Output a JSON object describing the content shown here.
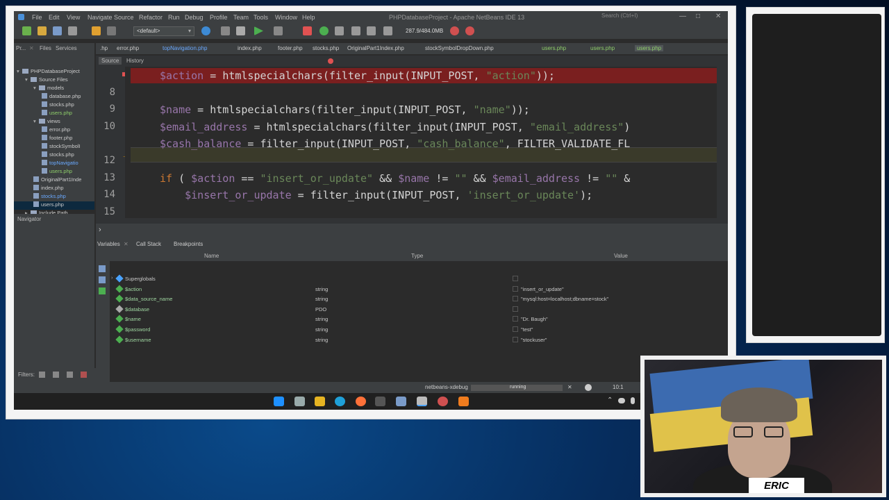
{
  "window": {
    "title": "PHPDatabaseProject - Apache NetBeans IDE 13",
    "search_placeholder": "Search (Ctrl+I)"
  },
  "menu": [
    "File",
    "Edit",
    "View",
    "Navigate",
    "Source",
    "Refactor",
    "Run",
    "Debug",
    "Profile",
    "Team",
    "Tools",
    "Window",
    "Help"
  ],
  "toolbar": {
    "config": "<default>",
    "memory": "287.9/484.0MB"
  },
  "project_panel": {
    "tabs": [
      "Pr...",
      "Files",
      "Services"
    ],
    "tree": [
      {
        "label": "PHPDatabaseProject",
        "depth": 0,
        "kind": "project"
      },
      {
        "label": "Source Files",
        "depth": 1,
        "kind": "folder"
      },
      {
        "label": "models",
        "depth": 2,
        "kind": "folder"
      },
      {
        "label": "database.php",
        "depth": 3,
        "kind": "file"
      },
      {
        "label": "stocks.php",
        "depth": 3,
        "kind": "file"
      },
      {
        "label": "users.php",
        "depth": 3,
        "kind": "file-mod"
      },
      {
        "label": "views",
        "depth": 2,
        "kind": "folder"
      },
      {
        "label": "error.php",
        "depth": 3,
        "kind": "file"
      },
      {
        "label": "footer.php",
        "depth": 3,
        "kind": "file"
      },
      {
        "label": "stockSymbolI",
        "depth": 3,
        "kind": "file"
      },
      {
        "label": "stocks.php",
        "depth": 3,
        "kind": "file"
      },
      {
        "label": "topNavigatio",
        "depth": 3,
        "kind": "file-link"
      },
      {
        "label": "users.php",
        "depth": 3,
        "kind": "file-mod"
      },
      {
        "label": "OriginalPart1Inde",
        "depth": 2,
        "kind": "file"
      },
      {
        "label": "index.php",
        "depth": 2,
        "kind": "file"
      },
      {
        "label": "stocks.php",
        "depth": 2,
        "kind": "file-link"
      },
      {
        "label": "users.php",
        "depth": 2,
        "kind": "file-sel"
      },
      {
        "label": "Include Path",
        "depth": 1,
        "kind": "folder"
      }
    ],
    "navigator_label": "Navigator"
  },
  "editor_tabs": [
    ".hp",
    "error.php",
    "topNavigation.php",
    "index.php",
    "footer.php",
    "stocks.php",
    "OriginalPart1Index.php",
    "stockSymbolDropDown.php",
    "users.php",
    "users.php",
    "users.php"
  ],
  "source_tabs": [
    "Source",
    "History"
  ],
  "code": {
    "lines": [
      {
        "num": "",
        "parts": [
          [
            "v",
            "$action"
          ],
          [
            "f",
            " = "
          ],
          [
            "f",
            "htmlspecialchars"
          ],
          [
            "f",
            "("
          ],
          [
            "f",
            "filter_input"
          ],
          [
            "f",
            "(INPUT_POST, "
          ],
          [
            "s",
            "\"action\""
          ],
          [
            "f",
            "));"
          ]
        ]
      },
      {
        "num": "8",
        "parts": []
      },
      {
        "num": "9",
        "parts": [
          [
            "v",
            "$name"
          ],
          [
            "f",
            " = "
          ],
          [
            "f",
            "htmlspecialchars"
          ],
          [
            "f",
            "("
          ],
          [
            "f",
            "filter_input"
          ],
          [
            "f",
            "(INPUT_POST, "
          ],
          [
            "s",
            "\"name\""
          ],
          [
            "f",
            "));"
          ]
        ]
      },
      {
        "num": "10",
        "parts": [
          [
            "v",
            "$email_address"
          ],
          [
            "f",
            " = "
          ],
          [
            "f",
            "htmlspecialchars"
          ],
          [
            "f",
            "("
          ],
          [
            "f",
            "filter_input"
          ],
          [
            "f",
            "(INPUT_POST, "
          ],
          [
            "s",
            "\"email_address\""
          ],
          [
            "f",
            ")"
          ]
        ]
      },
      {
        "num": "",
        "parts": [
          [
            "v",
            "$cash_balance"
          ],
          [
            "f",
            " = "
          ],
          [
            "f",
            "filter_input"
          ],
          [
            "f",
            "(INPUT_POST, "
          ],
          [
            "s",
            "\"cash_balance\""
          ],
          [
            "f",
            ", FILTER_VALIDATE_FL"
          ]
        ]
      },
      {
        "num": "12",
        "parts": []
      },
      {
        "num": "13",
        "parts": [
          [
            "k",
            "if"
          ],
          [
            "f",
            " ( "
          ],
          [
            "v",
            "$action"
          ],
          [
            "f",
            " == "
          ],
          [
            "s",
            "\"insert_or_update\""
          ],
          [
            "f",
            " && "
          ],
          [
            "v",
            "$name"
          ],
          [
            "f",
            " != "
          ],
          [
            "s",
            "\"\""
          ],
          [
            "f",
            " && "
          ],
          [
            "v",
            "$email_address"
          ],
          [
            "f",
            " != "
          ],
          [
            "s",
            "\"\""
          ],
          [
            "f",
            " &"
          ]
        ]
      },
      {
        "num": "14",
        "parts": [
          [
            "f",
            "    "
          ],
          [
            "v",
            "$insert_or_update"
          ],
          [
            "f",
            " = "
          ],
          [
            "f",
            "filter_input"
          ],
          [
            "f",
            "(INPUT_POST, "
          ],
          [
            "s",
            "'insert_or_update'"
          ],
          [
            "f",
            ");"
          ]
        ]
      },
      {
        "num": "15",
        "parts": []
      }
    ]
  },
  "debug_tabs": [
    "Variables",
    "Call Stack",
    "Breakpoints"
  ],
  "variables": {
    "headers": [
      "Name",
      "Type",
      "Value"
    ],
    "rows": [
      {
        "name": "Superglobals",
        "type": "",
        "value": ""
      },
      {
        "name": "$action",
        "type": "string",
        "value": "\"insert_or_update\""
      },
      {
        "name": "$data_source_name",
        "type": "string",
        "value": "\"mysql:host=localhost;dbname=stock\""
      },
      {
        "name": "$database",
        "type": "PDO",
        "value": ""
      },
      {
        "name": "$name",
        "type": "string",
        "value": "\"Dr. Baugh\""
      },
      {
        "name": "$password",
        "type": "string",
        "value": "\"test\""
      },
      {
        "name": "$username",
        "type": "string",
        "value": "\"stockuser\""
      }
    ]
  },
  "filters_label": "Filters:",
  "status": {
    "session": "netbeans-xdebug",
    "state": "running",
    "position": "10:1"
  },
  "webcam": {
    "name_tag": "ERIC"
  },
  "colors": {
    "ide_bg": "#2b2b2b",
    "breakpoint_line": "#7a1f1f",
    "string": "#6a8759",
    "variable": "#9876aa",
    "keyword": "#cc7832"
  }
}
